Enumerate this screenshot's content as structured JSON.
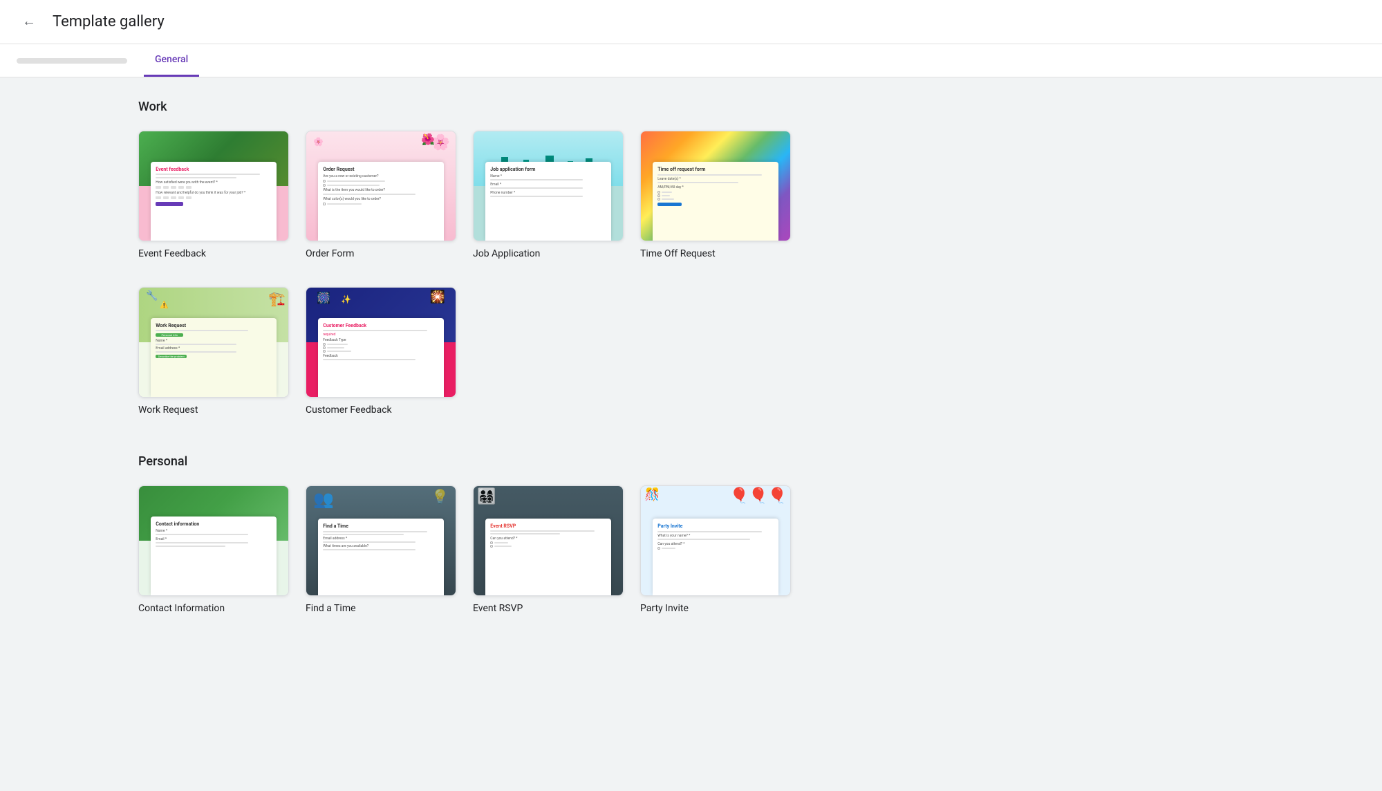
{
  "header": {
    "back_label": "←",
    "title": "Template gallery"
  },
  "tabs": {
    "blurred_tab": "████████████",
    "active_tab": "General"
  },
  "work_section": {
    "title": "Work",
    "templates": [
      {
        "id": "event-feedback",
        "name": "Event Feedback",
        "thumb_style": "event-feedback",
        "form_title": "Event feedback",
        "color": "#e91e63"
      },
      {
        "id": "order-form",
        "name": "Order Form",
        "thumb_style": "order-form",
        "form_title": "Order Request",
        "color": "#e91e63"
      },
      {
        "id": "job-application",
        "name": "Job Application",
        "thumb_style": "job-application",
        "form_title": "Job application form",
        "color": "#00796b"
      },
      {
        "id": "time-off-request",
        "name": "Time Off Request",
        "thumb_style": "time-off",
        "form_title": "Time off request form",
        "color": "#1976d2"
      }
    ],
    "templates_row2": [
      {
        "id": "work-request",
        "name": "Work Request",
        "thumb_style": "work-request",
        "form_title": "Work Request",
        "color": "#388e3c"
      },
      {
        "id": "customer-feedback",
        "name": "Customer Feedback",
        "thumb_style": "customer-feedback",
        "form_title": "Customer Feedback",
        "color": "#e91e63"
      }
    ]
  },
  "personal_section": {
    "title": "Personal",
    "templates": [
      {
        "id": "contact-info",
        "name": "Contact Information",
        "thumb_style": "contact-info",
        "form_title": "Contact information",
        "color": "#388e3c"
      },
      {
        "id": "find-a-time",
        "name": "Find a Time",
        "thumb_style": "find-time",
        "form_title": "Find a Time",
        "color": "#546e7a"
      },
      {
        "id": "event-rsvp",
        "name": "Event RSVP",
        "thumb_style": "event-rsvp",
        "form_title": "Event RSVP",
        "color": "#e53935"
      },
      {
        "id": "party-invite",
        "name": "Party Invite",
        "thumb_style": "party-invite",
        "form_title": "Party Invite",
        "color": "#1976d2"
      }
    ]
  }
}
